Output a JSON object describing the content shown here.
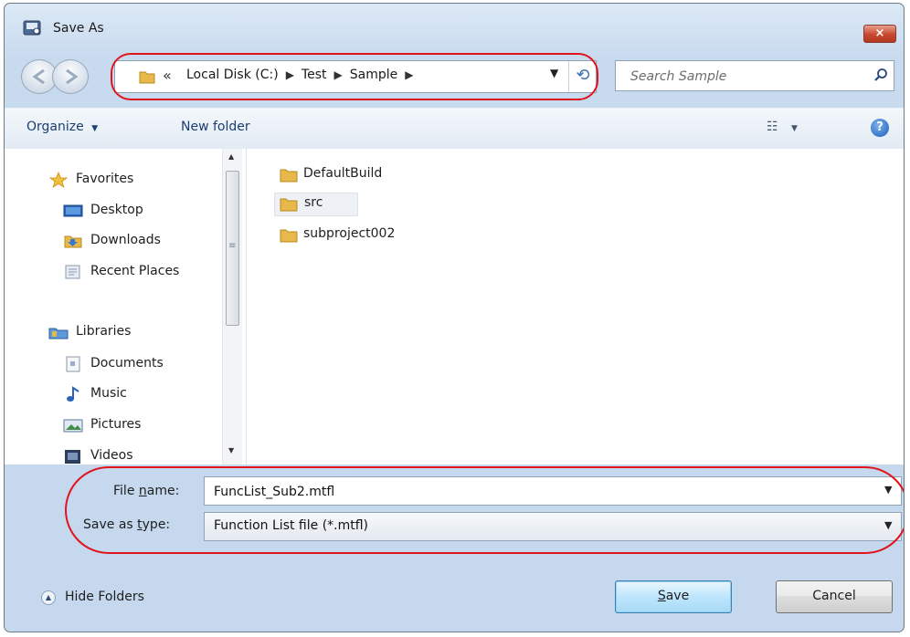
{
  "window": {
    "title": "Save As",
    "close_glyph": "×"
  },
  "navigation": {
    "back_icon": "back-arrow-icon",
    "forward_icon": "forward-arrow-icon"
  },
  "address_bar": {
    "overflow_chevrons": "«",
    "crumbs": [
      "Local Disk (C:)",
      "Test",
      "Sample"
    ],
    "separator": "▶",
    "dropdown_glyph": "▼",
    "refresh_glyph": "⟲"
  },
  "search": {
    "placeholder": "Search Sample",
    "icon": "search-icon"
  },
  "toolbar": {
    "organize_label": "Organize",
    "organize_arrow": "▼",
    "new_folder_label": "New folder",
    "views_glyph": "☷",
    "views_arrow": "▼",
    "help_glyph": "?"
  },
  "nav_pane": {
    "favorites": {
      "label": "Favorites",
      "items": [
        "Desktop",
        "Downloads",
        "Recent Places"
      ]
    },
    "libraries": {
      "label": "Libraries",
      "items": [
        "Documents",
        "Music",
        "Pictures",
        "Videos"
      ]
    },
    "scroll_up": "▲",
    "scroll_down": "▼",
    "scroll_grip": "≡"
  },
  "files": [
    {
      "name": "DefaultBuild",
      "selected": false
    },
    {
      "name": "src",
      "selected": true
    },
    {
      "name": "subproject002",
      "selected": false
    }
  ],
  "form": {
    "filename_label_pre": "File ",
    "filename_label_key": "n",
    "filename_label_post": "ame:",
    "filename_value": "FuncList_Sub2.mtfl",
    "savetype_label_pre": "Save as ",
    "savetype_label_key": "t",
    "savetype_label_post": "ype:",
    "savetype_value": "Function List file (*.mtfl)",
    "dropdown_glyph": "▼"
  },
  "footer": {
    "hide_folders_label": "Hide Folders",
    "hide_folders_glyph": "▲",
    "save_key": "S",
    "save_rest": "ave",
    "cancel_label": "Cancel"
  },
  "colors": {
    "annotation": "#e0141c",
    "folder": "#e8b84a"
  }
}
